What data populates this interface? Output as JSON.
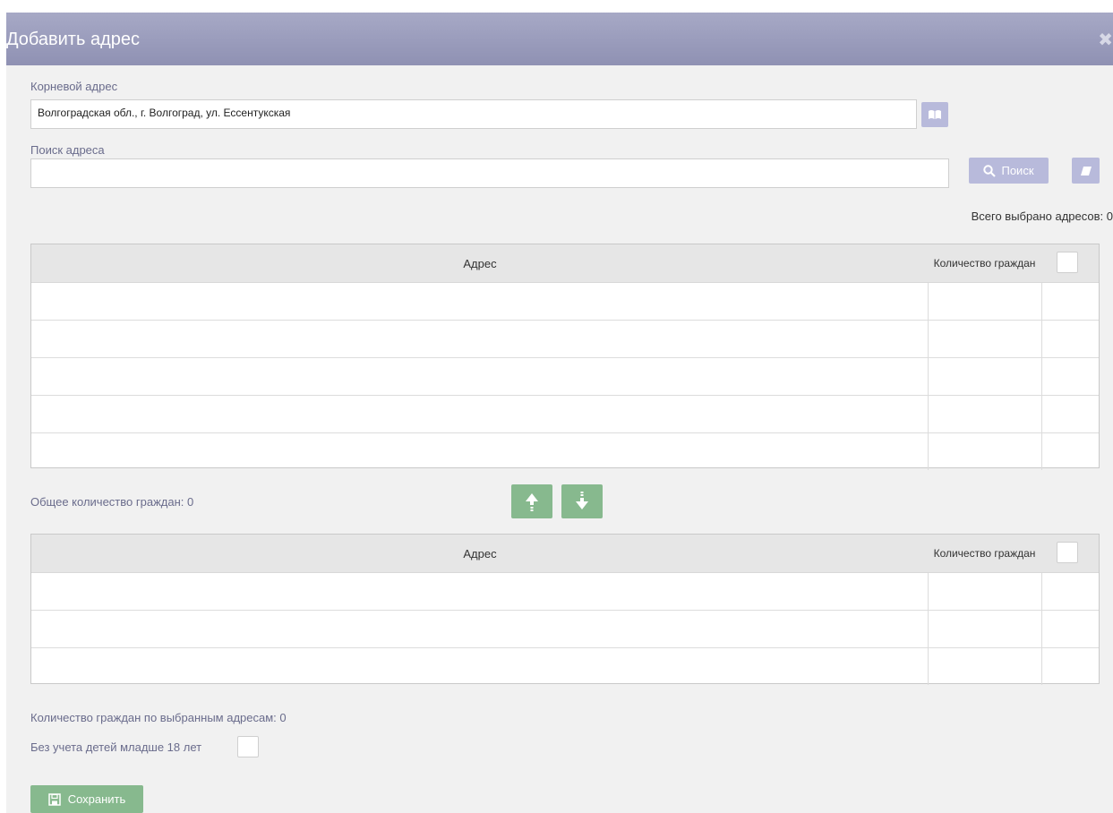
{
  "dialog": {
    "title": "Добавить адрес",
    "close_icon": "close-icon"
  },
  "root_address": {
    "label": "Корневой адрес",
    "value": "Волгоградская обл., г. Волгоград, ул. Ессентукская",
    "picker_icon": "book-icon"
  },
  "search": {
    "label": "Поиск адреса",
    "value": "",
    "placeholder": "",
    "button_label": "Поиск",
    "button_icon": "search-icon",
    "clear_icon": "eraser-icon"
  },
  "selected_total": "Всего выбрано адресов: 0",
  "top_grid": {
    "columns": [
      "Адрес",
      "Количество граждан"
    ],
    "row_count_visible": 5
  },
  "total_citizens": "Общее количество граждан: 0",
  "move_buttons": {
    "up_icon": "arrow-up-icon",
    "down_icon": "arrow-down-icon"
  },
  "bottom_grid": {
    "columns": [
      "Адрес",
      "Количество граждан"
    ],
    "row_count_visible": 3
  },
  "selected_citizens": "Количество граждан по выбранным адресам: 0",
  "exclude_children": {
    "label": "Без учета детей младше 18 лет",
    "checked": false
  },
  "save": {
    "label": "Сохранить",
    "icon": "save-icon"
  },
  "colors": {
    "header": "#9a9cbd",
    "accent_buttons": "#b8badb",
    "green_buttons": "#87b98e",
    "label_text": "#6a6c8c"
  }
}
